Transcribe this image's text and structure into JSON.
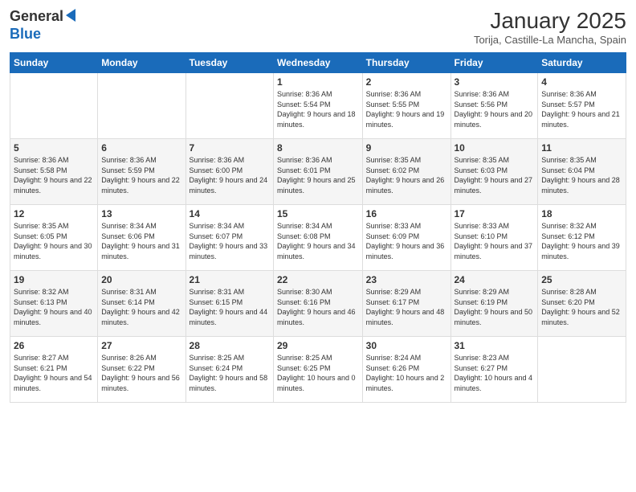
{
  "logo": {
    "line1": "General",
    "line2": "Blue"
  },
  "title": "January 2025",
  "subtitle": "Torija, Castille-La Mancha, Spain",
  "weekdays": [
    "Sunday",
    "Monday",
    "Tuesday",
    "Wednesday",
    "Thursday",
    "Friday",
    "Saturday"
  ],
  "weeks": [
    [
      {
        "day": "",
        "text": ""
      },
      {
        "day": "",
        "text": ""
      },
      {
        "day": "",
        "text": ""
      },
      {
        "day": "1",
        "text": "Sunrise: 8:36 AM\nSunset: 5:54 PM\nDaylight: 9 hours and 18 minutes."
      },
      {
        "day": "2",
        "text": "Sunrise: 8:36 AM\nSunset: 5:55 PM\nDaylight: 9 hours and 19 minutes."
      },
      {
        "day": "3",
        "text": "Sunrise: 8:36 AM\nSunset: 5:56 PM\nDaylight: 9 hours and 20 minutes."
      },
      {
        "day": "4",
        "text": "Sunrise: 8:36 AM\nSunset: 5:57 PM\nDaylight: 9 hours and 21 minutes."
      }
    ],
    [
      {
        "day": "5",
        "text": "Sunrise: 8:36 AM\nSunset: 5:58 PM\nDaylight: 9 hours and 22 minutes."
      },
      {
        "day": "6",
        "text": "Sunrise: 8:36 AM\nSunset: 5:59 PM\nDaylight: 9 hours and 22 minutes."
      },
      {
        "day": "7",
        "text": "Sunrise: 8:36 AM\nSunset: 6:00 PM\nDaylight: 9 hours and 24 minutes."
      },
      {
        "day": "8",
        "text": "Sunrise: 8:36 AM\nSunset: 6:01 PM\nDaylight: 9 hours and 25 minutes."
      },
      {
        "day": "9",
        "text": "Sunrise: 8:35 AM\nSunset: 6:02 PM\nDaylight: 9 hours and 26 minutes."
      },
      {
        "day": "10",
        "text": "Sunrise: 8:35 AM\nSunset: 6:03 PM\nDaylight: 9 hours and 27 minutes."
      },
      {
        "day": "11",
        "text": "Sunrise: 8:35 AM\nSunset: 6:04 PM\nDaylight: 9 hours and 28 minutes."
      }
    ],
    [
      {
        "day": "12",
        "text": "Sunrise: 8:35 AM\nSunset: 6:05 PM\nDaylight: 9 hours and 30 minutes."
      },
      {
        "day": "13",
        "text": "Sunrise: 8:34 AM\nSunset: 6:06 PM\nDaylight: 9 hours and 31 minutes."
      },
      {
        "day": "14",
        "text": "Sunrise: 8:34 AM\nSunset: 6:07 PM\nDaylight: 9 hours and 33 minutes."
      },
      {
        "day": "15",
        "text": "Sunrise: 8:34 AM\nSunset: 6:08 PM\nDaylight: 9 hours and 34 minutes."
      },
      {
        "day": "16",
        "text": "Sunrise: 8:33 AM\nSunset: 6:09 PM\nDaylight: 9 hours and 36 minutes."
      },
      {
        "day": "17",
        "text": "Sunrise: 8:33 AM\nSunset: 6:10 PM\nDaylight: 9 hours and 37 minutes."
      },
      {
        "day": "18",
        "text": "Sunrise: 8:32 AM\nSunset: 6:12 PM\nDaylight: 9 hours and 39 minutes."
      }
    ],
    [
      {
        "day": "19",
        "text": "Sunrise: 8:32 AM\nSunset: 6:13 PM\nDaylight: 9 hours and 40 minutes."
      },
      {
        "day": "20",
        "text": "Sunrise: 8:31 AM\nSunset: 6:14 PM\nDaylight: 9 hours and 42 minutes."
      },
      {
        "day": "21",
        "text": "Sunrise: 8:31 AM\nSunset: 6:15 PM\nDaylight: 9 hours and 44 minutes."
      },
      {
        "day": "22",
        "text": "Sunrise: 8:30 AM\nSunset: 6:16 PM\nDaylight: 9 hours and 46 minutes."
      },
      {
        "day": "23",
        "text": "Sunrise: 8:29 AM\nSunset: 6:17 PM\nDaylight: 9 hours and 48 minutes."
      },
      {
        "day": "24",
        "text": "Sunrise: 8:29 AM\nSunset: 6:19 PM\nDaylight: 9 hours and 50 minutes."
      },
      {
        "day": "25",
        "text": "Sunrise: 8:28 AM\nSunset: 6:20 PM\nDaylight: 9 hours and 52 minutes."
      }
    ],
    [
      {
        "day": "26",
        "text": "Sunrise: 8:27 AM\nSunset: 6:21 PM\nDaylight: 9 hours and 54 minutes."
      },
      {
        "day": "27",
        "text": "Sunrise: 8:26 AM\nSunset: 6:22 PM\nDaylight: 9 hours and 56 minutes."
      },
      {
        "day": "28",
        "text": "Sunrise: 8:25 AM\nSunset: 6:24 PM\nDaylight: 9 hours and 58 minutes."
      },
      {
        "day": "29",
        "text": "Sunrise: 8:25 AM\nSunset: 6:25 PM\nDaylight: 10 hours and 0 minutes."
      },
      {
        "day": "30",
        "text": "Sunrise: 8:24 AM\nSunset: 6:26 PM\nDaylight: 10 hours and 2 minutes."
      },
      {
        "day": "31",
        "text": "Sunrise: 8:23 AM\nSunset: 6:27 PM\nDaylight: 10 hours and 4 minutes."
      },
      {
        "day": "",
        "text": ""
      }
    ]
  ]
}
